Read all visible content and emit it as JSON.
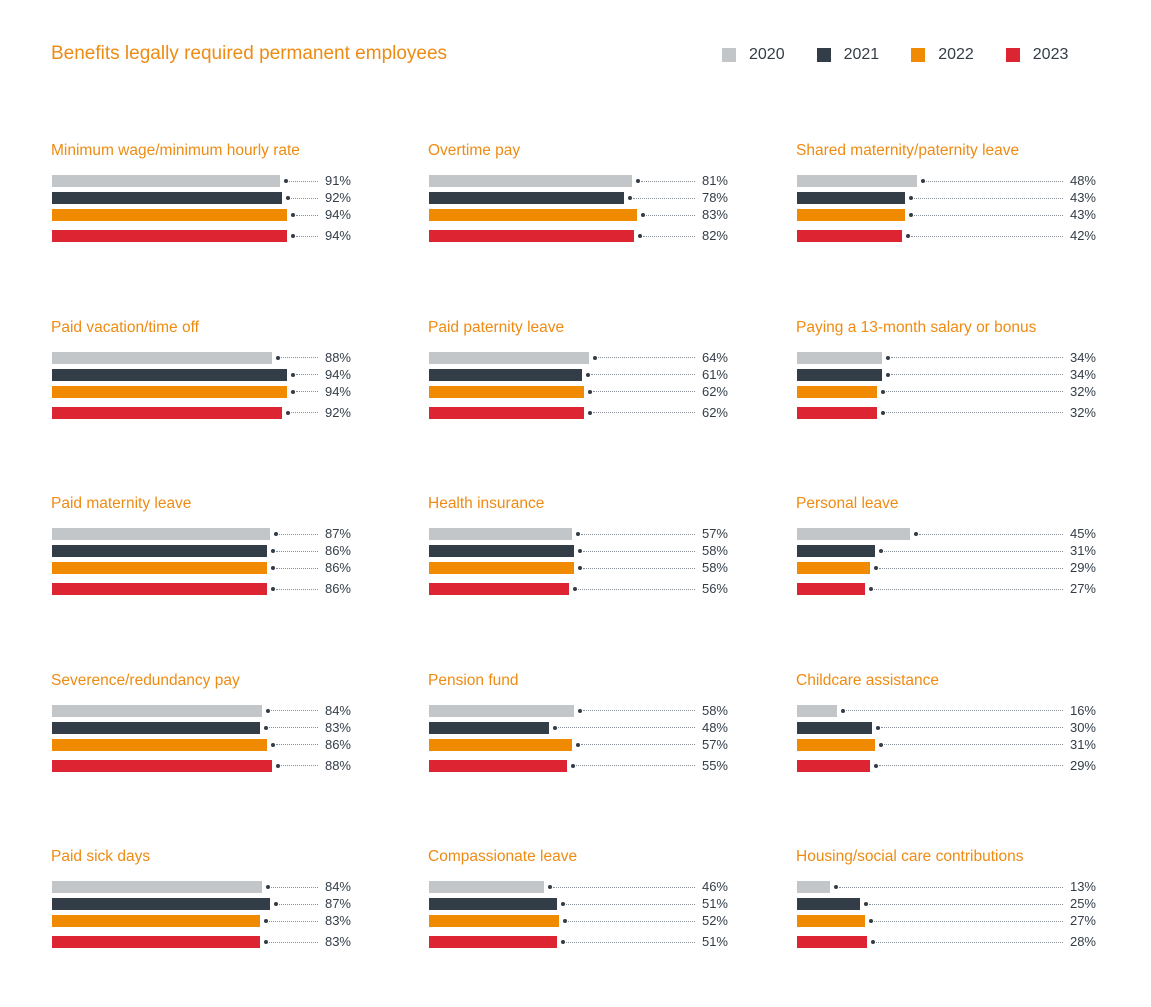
{
  "chart_data": {
    "type": "bar",
    "orientation": "horizontal",
    "title": "Benefits legally required permanent employees",
    "xlim": [
      0,
      100
    ],
    "unit": "%",
    "grid": false,
    "legend_position": "top-right",
    "series_names": [
      "2020",
      "2021",
      "2022",
      "2023"
    ],
    "series_colors": [
      "#c3c6c9",
      "#323d47",
      "#f08a00",
      "#dc2432"
    ],
    "panels": [
      {
        "title": "Minimum wage/minimum hourly rate",
        "values": [
          91,
          92,
          94,
          94
        ]
      },
      {
        "title": "Overtime pay",
        "values": [
          81,
          78,
          83,
          82
        ]
      },
      {
        "title": "Shared maternity/paternity leave",
        "values": [
          48,
          43,
          43,
          42
        ]
      },
      {
        "title": "Paid vacation/time off",
        "values": [
          88,
          94,
          94,
          92
        ]
      },
      {
        "title": "Paid paternity leave",
        "values": [
          64,
          61,
          62,
          62
        ]
      },
      {
        "title": "Paying a 13-month salary or bonus",
        "values": [
          34,
          34,
          32,
          32
        ]
      },
      {
        "title": "Paid maternity leave",
        "values": [
          87,
          86,
          86,
          86
        ]
      },
      {
        "title": "Health insurance",
        "values": [
          57,
          58,
          58,
          56
        ]
      },
      {
        "title": "Personal leave",
        "values": [
          45,
          31,
          29,
          27
        ]
      },
      {
        "title": "Severence/redundancy pay",
        "values": [
          84,
          83,
          86,
          88
        ]
      },
      {
        "title": "Pension fund",
        "values": [
          58,
          48,
          57,
          55
        ]
      },
      {
        "title": "Childcare assistance",
        "values": [
          16,
          30,
          31,
          29
        ]
      },
      {
        "title": "Paid sick days",
        "values": [
          84,
          87,
          83,
          83
        ]
      },
      {
        "title": "Compassionate leave",
        "values": [
          46,
          51,
          52,
          51
        ]
      },
      {
        "title": "Housing/social care contributions",
        "values": [
          13,
          25,
          27,
          28
        ]
      }
    ]
  },
  "legend": {
    "items": [
      {
        "label": "2020",
        "color": "#c3c6c9"
      },
      {
        "label": "2021",
        "color": "#323d47"
      },
      {
        "label": "2022",
        "color": "#f08a00"
      },
      {
        "label": "2023",
        "color": "#dc2432"
      }
    ]
  }
}
